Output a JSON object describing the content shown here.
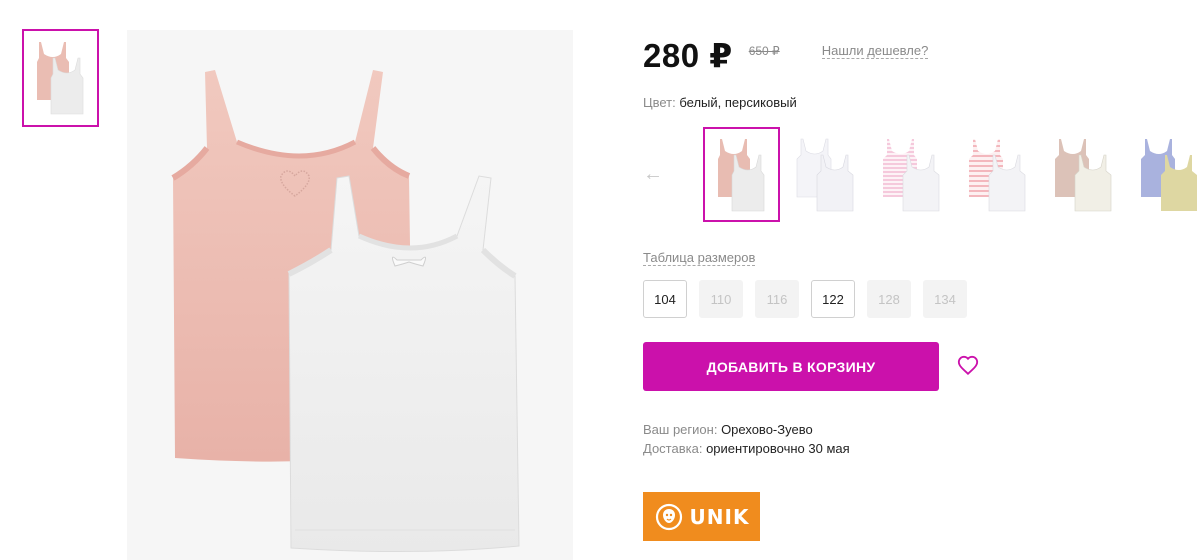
{
  "product": {
    "price": "280 ₽",
    "old_price": "650 ₽",
    "found_cheaper_label": "Нашли дешевле?",
    "color_label": "Цвет:",
    "color_value": "белый, персиковый",
    "size_table_label": "Таблица размеров",
    "sizes": [
      {
        "label": "104",
        "available": true
      },
      {
        "label": "110",
        "available": false
      },
      {
        "label": "116",
        "available": false
      },
      {
        "label": "122",
        "available": true
      },
      {
        "label": "128",
        "available": false
      },
      {
        "label": "134",
        "available": false
      }
    ],
    "add_to_cart_label": "ДОБАВИТЬ В КОРЗИНУ",
    "region_label": "Ваш регион:",
    "region_value": "Орехово-Зуево",
    "delivery_label": "Доставка:",
    "delivery_value": "ориентировочно 30 мая",
    "brand_logo_text": "UNIK"
  },
  "colors": {
    "accent": "#cb11ab",
    "brand_orange": "#f08c1e"
  },
  "icons": {
    "arrow_left": "arrow-left-icon",
    "wishlist": "heart-icon"
  }
}
